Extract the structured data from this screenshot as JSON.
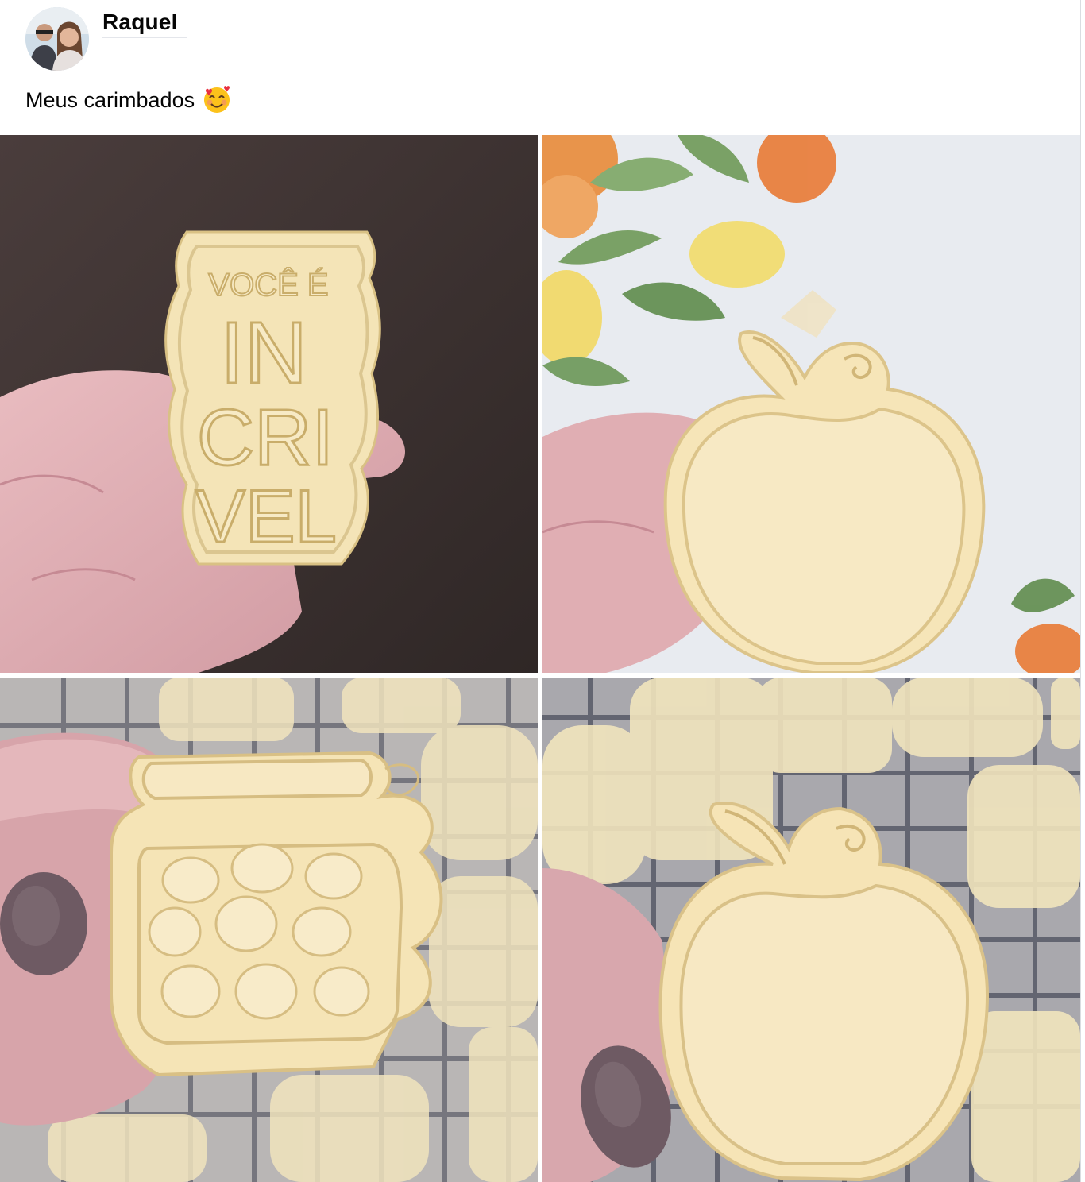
{
  "post": {
    "author": "Raquel",
    "caption": "Meus carimbados",
    "caption_emoji": "smiling-face-with-hearts-icon"
  },
  "photos": [
    {
      "name": "cookie-voce-e-incrivel",
      "stamp_lines": [
        "VOCÊ É",
        "IN",
        "CRI",
        "VEL"
      ]
    },
    {
      "name": "cookie-apple-on-floral-cloth"
    },
    {
      "name": "cookie-heart-jar"
    },
    {
      "name": "cookie-apple-on-cooling-rack"
    }
  ],
  "colors": {
    "text": "#050505",
    "dough": "#f6e6b8",
    "dough_shadow": "#dcc48a",
    "wood": "#3e3433",
    "skin": "#e2b0b4",
    "nail": "#6e5a63",
    "cloth": "#e9ecf1",
    "rack": "#4a4d5a"
  }
}
